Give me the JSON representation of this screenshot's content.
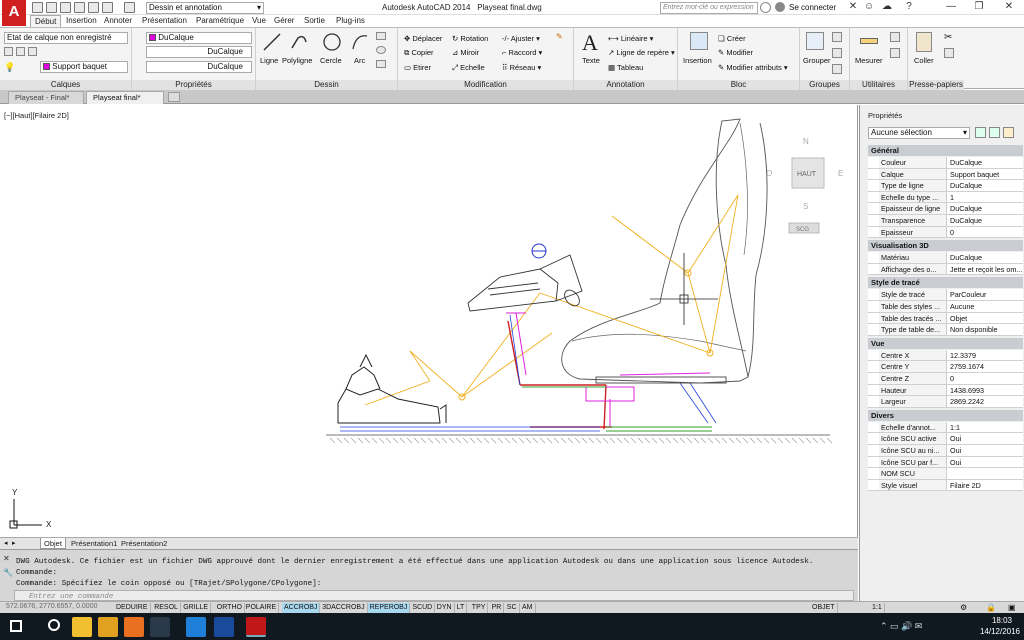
{
  "app": {
    "title": "Autodesk AutoCAD 2014",
    "file": "Playseat final.dwg",
    "workspace": "Dessin et annotation",
    "search_placeholder": "Entrez mot-clé ou expression",
    "signin": "Se connecter"
  },
  "ribbon_tabs": [
    "Début",
    "Insertion",
    "Annoter",
    "Présentation",
    "Paramétrique",
    "Vue",
    "Gérer",
    "Sortie",
    "Plug-ins"
  ],
  "ribbon": {
    "calques": {
      "footer": "Calques",
      "state": "Etat de calque non enregistré",
      "current_layer": "Support baquet"
    },
    "proprietes": {
      "footer": "Propriétés",
      "color": "DuCalque",
      "linetype": "DuCalque",
      "lineweight": "DuCalque"
    },
    "dessin": {
      "footer": "Dessin",
      "tools": [
        "Ligne",
        "Polyligne",
        "Cercle",
        "Arc"
      ]
    },
    "modification": {
      "footer": "Modification",
      "col1": [
        "Déplacer",
        "Copier",
        "Etirer"
      ],
      "col2": [
        "Rotation",
        "Miroir",
        "Echelle"
      ],
      "col3": [
        "Ajuster",
        "Raccord",
        "Réseau"
      ]
    },
    "annotation": {
      "footer": "Annotation",
      "texte": "Texte",
      "items": [
        "Linéaire",
        "Ligne de repère",
        "Tableau"
      ]
    },
    "bloc": {
      "footer": "Bloc",
      "insertion": "Insertion",
      "items": [
        "Créer",
        "Modifier",
        "Modifier attributs"
      ]
    },
    "groupes": {
      "footer": "Groupes",
      "label": "Grouper"
    },
    "utilitaires": {
      "footer": "Utilitaires",
      "label": "Mesurer"
    },
    "presse": {
      "footer": "Presse-papiers",
      "label": "Coller"
    }
  },
  "doc_tabs": [
    "Playseat - Final*",
    "Playseat final*"
  ],
  "viewport": {
    "label": "[−][Haut][Filaire 2D]",
    "cube_top": "HAUT",
    "cube_n": "N",
    "cube_s": "S",
    "cube_e": "E",
    "cube_o": "O",
    "scu": "SCG",
    "axis_x": "X",
    "axis_y": "Y"
  },
  "layout_tabs": [
    "Objet",
    "Présentation1",
    "Présentation2"
  ],
  "command": {
    "lines": [
      "DWG Autodesk.  Ce fichier est un fichier DWG approuvé dont le dernier enregistrement a été effectué dans une application Autodesk ou dans une application sous licence Autodesk.",
      "Commande:",
      "Commande: Spécifiez le coin opposé ou [TRajet/SPolygone/CPolygone]:"
    ],
    "placeholder": "Entrez une commande"
  },
  "status": {
    "coords": "572.0676, 2770.6557, 0.0000",
    "buttons": [
      "DEDUIRE",
      "RESOL",
      "GRILLE",
      "ORTHO",
      "POLAIRE",
      "ACCROBJ",
      "3DACCROBJ",
      "REPEROBJ",
      "SCUD",
      "DYN",
      "LT",
      "TPY",
      "PR",
      "SC",
      "AM"
    ],
    "on_buttons": [
      "ACCROBJ",
      "REPEROBJ"
    ],
    "objet": "OBJET",
    "scale": "1:1"
  },
  "properties": {
    "title": "Propriétés",
    "selection": "Aucune sélection",
    "sections": [
      {
        "name": "Général",
        "rows": [
          [
            "Couleur",
            "DuCalque"
          ],
          [
            "Calque",
            "Support baquet"
          ],
          [
            "Type de ligne",
            "DuCalque"
          ],
          [
            "Echelle du type ...",
            "1"
          ],
          [
            "Epaisseur de ligne",
            "DuCalque"
          ],
          [
            "Transparence",
            "DuCalque"
          ],
          [
            "Epaisseur",
            "0"
          ]
        ]
      },
      {
        "name": "Visualisation 3D",
        "rows": [
          [
            "Matériau",
            "DuCalque"
          ],
          [
            "Affichage des o...",
            "Jette et reçoit les om..."
          ]
        ]
      },
      {
        "name": "Style de tracé",
        "rows": [
          [
            "Style de tracé",
            "ParCouleur"
          ],
          [
            "Table des styles ...",
            "Aucune"
          ],
          [
            "Table des tracés ...",
            "Objet"
          ],
          [
            "Type de table de...",
            "Non disponible"
          ]
        ]
      },
      {
        "name": "Vue",
        "rows": [
          [
            "Centre X",
            "12.3379"
          ],
          [
            "Centre Y",
            "2759.1674"
          ],
          [
            "Centre Z",
            "0"
          ],
          [
            "Hauteur",
            "1438.6993"
          ],
          [
            "Largeur",
            "2869.2242"
          ]
        ]
      },
      {
        "name": "Divers",
        "rows": [
          [
            "Echelle d'annot...",
            "1:1"
          ],
          [
            "Icône SCU active",
            "Oui"
          ],
          [
            "Icône SCU au ni...",
            "Oui"
          ],
          [
            "Icône SCU par f...",
            "Oui"
          ],
          [
            "NOM SCU",
            ""
          ],
          [
            "Style visuel",
            "Filaire 2D"
          ]
        ]
      }
    ]
  },
  "taskbar": {
    "time": "18:03",
    "date": "14/12/2016"
  }
}
